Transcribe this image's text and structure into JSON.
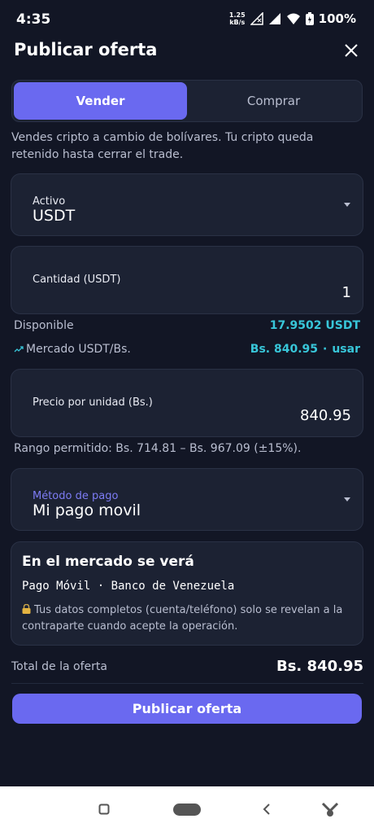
{
  "status": {
    "time": "4:35",
    "net_speed_value": "1.25",
    "net_speed_unit": "kB/s",
    "battery": "100%"
  },
  "header": {
    "title": "Publicar oferta"
  },
  "tabs": [
    {
      "label": "Vender",
      "active": true
    },
    {
      "label": "Comprar",
      "active": false
    }
  ],
  "helper_text": "Vendes cripto a cambio de bolívares. Tu cripto queda retenido hasta cerrar el trade.",
  "asset": {
    "label": "Activo",
    "value": "USDT"
  },
  "amount": {
    "label": "Cantidad (USDT)",
    "value": "1"
  },
  "available": {
    "label": "Disponible",
    "value": "17.9502 USDT"
  },
  "market": {
    "label": "Mercado USDT/Bs.",
    "value": "Bs. 840.95",
    "separator": "·",
    "action": "usar"
  },
  "price": {
    "label": "Precio por unidad (Bs.)",
    "value": "840.95"
  },
  "range_text": "Rango permitido: Bs. 714.81 – Bs. 967.09 (±15%).",
  "payment": {
    "label": "Método de pago",
    "value": "Mi pago movil"
  },
  "market_preview": {
    "title": "En el mercado se verá",
    "method": "Pago Móvil · Banco de Venezuela",
    "note": "Tus datos completos (cuenta/teléfono) solo se revelan a la contraparte cuando acepte la operación."
  },
  "total": {
    "label": "Total de la oferta",
    "value": "Bs. 840.95"
  },
  "publish_button": "Publicar oferta",
  "colors": {
    "background": "#121625",
    "card": "#1c2233",
    "accent": "#6a69f0",
    "cyan": "#38c6d9"
  }
}
